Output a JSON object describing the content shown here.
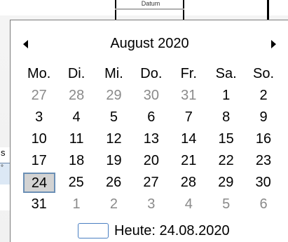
{
  "background": {
    "cut_label": "Datum",
    "stub_s": "s",
    "stub_mark": "°"
  },
  "calendar": {
    "month_title": "August 2020",
    "weekdays": [
      "Mo.",
      "Di.",
      "Mi.",
      "Do.",
      "Fr.",
      "Sa.",
      "So."
    ],
    "weeks": [
      [
        {
          "d": "27",
          "other": true
        },
        {
          "d": "28",
          "other": true
        },
        {
          "d": "29",
          "other": true
        },
        {
          "d": "30",
          "other": true
        },
        {
          "d": "31",
          "other": true
        },
        {
          "d": "1",
          "other": false
        },
        {
          "d": "2",
          "other": false
        }
      ],
      [
        {
          "d": "3",
          "other": false
        },
        {
          "d": "4",
          "other": false
        },
        {
          "d": "5",
          "other": false
        },
        {
          "d": "6",
          "other": false
        },
        {
          "d": "7",
          "other": false
        },
        {
          "d": "8",
          "other": false
        },
        {
          "d": "9",
          "other": false
        }
      ],
      [
        {
          "d": "10",
          "other": false
        },
        {
          "d": "11",
          "other": false
        },
        {
          "d": "12",
          "other": false
        },
        {
          "d": "13",
          "other": false
        },
        {
          "d": "14",
          "other": false
        },
        {
          "d": "15",
          "other": false
        },
        {
          "d": "16",
          "other": false
        }
      ],
      [
        {
          "d": "17",
          "other": false
        },
        {
          "d": "18",
          "other": false
        },
        {
          "d": "19",
          "other": false
        },
        {
          "d": "20",
          "other": false
        },
        {
          "d": "21",
          "other": false
        },
        {
          "d": "22",
          "other": false
        },
        {
          "d": "23",
          "other": false
        }
      ],
      [
        {
          "d": "24",
          "other": false,
          "selected": true
        },
        {
          "d": "25",
          "other": false
        },
        {
          "d": "26",
          "other": false
        },
        {
          "d": "27",
          "other": false
        },
        {
          "d": "28",
          "other": false
        },
        {
          "d": "29",
          "other": false
        },
        {
          "d": "30",
          "other": false
        }
      ],
      [
        {
          "d": "31",
          "other": false
        },
        {
          "d": "1",
          "other": true
        },
        {
          "d": "2",
          "other": true
        },
        {
          "d": "3",
          "other": true
        },
        {
          "d": "4",
          "other": true
        },
        {
          "d": "5",
          "other": true
        },
        {
          "d": "6",
          "other": true
        }
      ]
    ],
    "today_label": "Heute: 24.08.2020",
    "prev_icon": "triangle-left-icon",
    "next_icon": "triangle-right-icon",
    "colors": {
      "selected_bg": "#d3d3d3",
      "selected_border": "#6b8fb5",
      "today_border": "#4a7fc2",
      "other_month_text": "#8a8a8a"
    }
  }
}
